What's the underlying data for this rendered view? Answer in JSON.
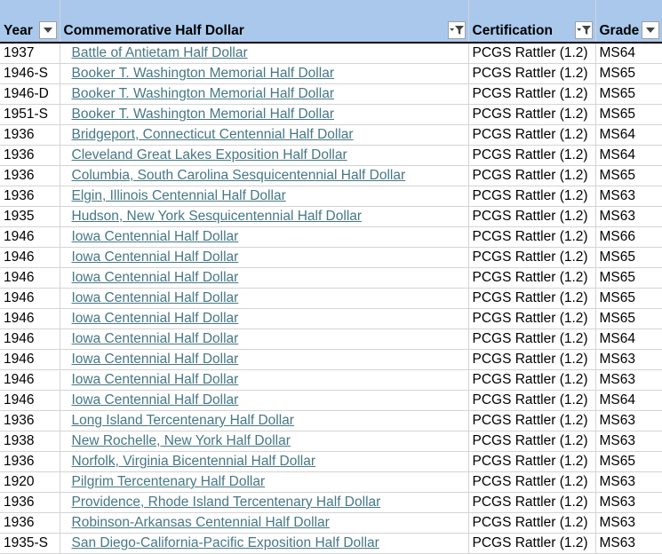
{
  "columns": [
    {
      "key": "year",
      "label": "Year",
      "filter": "dropdown"
    },
    {
      "key": "coin",
      "label": "Commemorative Half Dollar",
      "filter": "filtered"
    },
    {
      "key": "certification",
      "label": "Certification",
      "filter": "filtered"
    },
    {
      "key": "grade",
      "label": "Grade",
      "filter": "dropdown"
    }
  ],
  "colors": {
    "header_bg": "#a9c8ec",
    "link": "#467886",
    "gridline": "#d4d4d4"
  },
  "rows": [
    {
      "year": "1937",
      "coin": "Battle of Antietam Half Dollar",
      "certification": "PCGS Rattler (1.2)",
      "grade": "MS64"
    },
    {
      "year": "1946-S",
      "coin": "Booker T. Washington Memorial Half Dollar",
      "certification": "PCGS Rattler (1.2)",
      "grade": "MS65"
    },
    {
      "year": "1946-D",
      "coin": "Booker T. Washington Memorial Half Dollar",
      "certification": "PCGS Rattler (1.2)",
      "grade": "MS65"
    },
    {
      "year": "1951-S",
      "coin": "Booker T. Washington Memorial Half Dollar",
      "certification": "PCGS Rattler (1.2)",
      "grade": "MS65"
    },
    {
      "year": "1936",
      "coin": "Bridgeport, Connecticut Centennial Half Dollar",
      "certification": "PCGS Rattler (1.2)",
      "grade": "MS64"
    },
    {
      "year": "1936",
      "coin": "Cleveland Great Lakes Exposition Half Dollar",
      "certification": "PCGS Rattler (1.2)",
      "grade": "MS64"
    },
    {
      "year": "1936",
      "coin": "Columbia, South Carolina Sesquicentennial Half Dollar",
      "certification": "PCGS Rattler (1.2)",
      "grade": "MS65"
    },
    {
      "year": "1936",
      "coin": "Elgin, Illinois Centennial Half Dollar",
      "certification": "PCGS Rattler (1.2)",
      "grade": "MS63"
    },
    {
      "year": "1935",
      "coin": "Hudson, New York Sesquicentennial Half Dollar",
      "certification": "PCGS Rattler (1.2)",
      "grade": "MS63"
    },
    {
      "year": "1946",
      "coin": "Iowa Centennial Half Dollar",
      "certification": "PCGS Rattler (1.2)",
      "grade": "MS66"
    },
    {
      "year": "1946",
      "coin": "Iowa Centennial Half Dollar",
      "certification": "PCGS Rattler (1.2)",
      "grade": "MS65"
    },
    {
      "year": "1946",
      "coin": "Iowa Centennial Half Dollar",
      "certification": "PCGS Rattler (1.2)",
      "grade": "MS65"
    },
    {
      "year": "1946",
      "coin": "Iowa Centennial Half Dollar",
      "certification": "PCGS Rattler (1.2)",
      "grade": "MS65"
    },
    {
      "year": "1946",
      "coin": "Iowa Centennial Half Dollar",
      "certification": "PCGS Rattler (1.2)",
      "grade": "MS65"
    },
    {
      "year": "1946",
      "coin": "Iowa Centennial Half Dollar",
      "certification": "PCGS Rattler (1.2)",
      "grade": "MS64"
    },
    {
      "year": "1946",
      "coin": "Iowa Centennial Half Dollar",
      "certification": "PCGS Rattler (1.2)",
      "grade": "MS63"
    },
    {
      "year": "1946",
      "coin": "Iowa Centennial Half Dollar",
      "certification": "PCGS Rattler (1.2)",
      "grade": "MS63"
    },
    {
      "year": "1946",
      "coin": "Iowa Centennial Half Dollar",
      "certification": "PCGS Rattler (1.2)",
      "grade": "MS64"
    },
    {
      "year": "1936",
      "coin": "Long Island Tercentenary Half Dollar",
      "certification": "PCGS Rattler (1.2)",
      "grade": "MS63"
    },
    {
      "year": "1938",
      "coin": "New Rochelle, New York Half Dollar",
      "certification": "PCGS Rattler (1.2)",
      "grade": "MS63"
    },
    {
      "year": "1936",
      "coin": "Norfolk, Virginia Bicentennial Half Dollar",
      "certification": "PCGS Rattler (1.2)",
      "grade": "MS65"
    },
    {
      "year": "1920",
      "coin": "Pilgrim Tercentenary Half Dollar",
      "certification": "PCGS Rattler (1.2)",
      "grade": "MS63"
    },
    {
      "year": "1936",
      "coin": "Providence, Rhode Island Tercentenary Half Dollar",
      "certification": "PCGS Rattler (1.2)",
      "grade": "MS63"
    },
    {
      "year": "1936",
      "coin": "Robinson-Arkansas Centennial Half Dollar",
      "certification": "PCGS Rattler (1.2)",
      "grade": "MS63"
    },
    {
      "year": "1935-S",
      "coin": "San Diego-California-Pacific Exposition Half Dollar",
      "certification": "PCGS Rattler (1.2)",
      "grade": "MS63"
    }
  ]
}
